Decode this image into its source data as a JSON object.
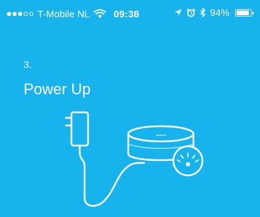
{
  "status_bar": {
    "carrier": "T-Mobile NL",
    "time": "09:38",
    "battery_percent": "94%",
    "battery_level": 0.94,
    "signal_strength": 3,
    "signal_max": 5
  },
  "step": {
    "number": "3.",
    "title": "Power Up"
  },
  "colors": {
    "background": "#16b3ec",
    "foreground": "#ffffff"
  },
  "illustration": {
    "icons": [
      "power-adapter-icon",
      "router-hub-icon",
      "power-button-icon"
    ]
  }
}
